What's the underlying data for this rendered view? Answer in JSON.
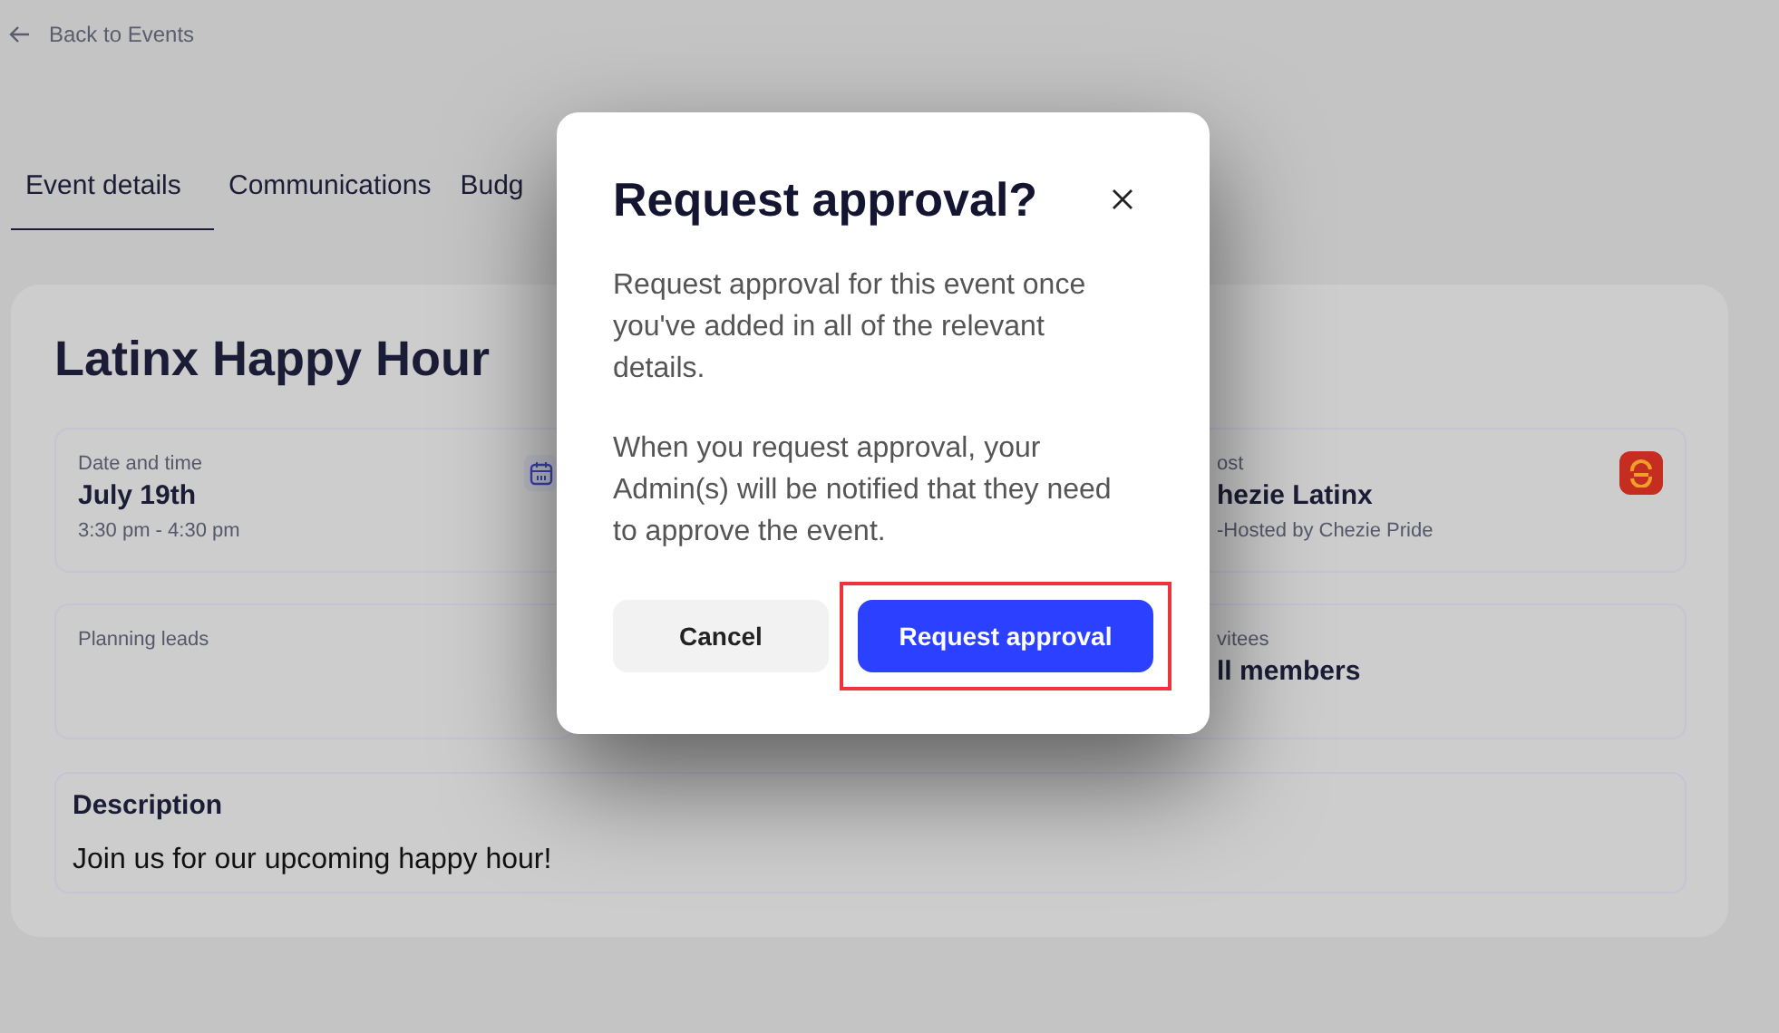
{
  "back_link": "Back to Events",
  "tabs": [
    {
      "label": "Event details",
      "selected": true
    },
    {
      "label": "Communications",
      "selected": false
    },
    {
      "label": "Budg",
      "selected": false
    }
  ],
  "event": {
    "title": "Latinx Happy Hour",
    "rows": [
      [
        {
          "kind": "date",
          "label": "Date and time",
          "value": "July 19th",
          "detail": "3:30 pm - 4:30 pm"
        },
        {
          "kind": "host",
          "label": "ost",
          "value": "hezie Latinx",
          "detail": "-Hosted by Chezie Pride"
        }
      ],
      [
        {
          "kind": "text",
          "label": "Planning leads"
        },
        {
          "kind": "text",
          "label": "vitees",
          "value": "ll members"
        }
      ]
    ],
    "description": {
      "label": "Description",
      "text": "Join us for our upcoming happy hour!"
    }
  },
  "dialog": {
    "title": "Request approval?",
    "paragraphs": [
      "Request approval for this event once you've added in all of the relevant details.",
      "When you request approval, your Admin(s) will be notified that they need to approve the event."
    ],
    "buttons": [
      {
        "label": "Cancel",
        "kind": "secondary",
        "highlighted": false
      },
      {
        "label": "Request approval",
        "kind": "primary",
        "highlighted": true
      }
    ]
  }
}
